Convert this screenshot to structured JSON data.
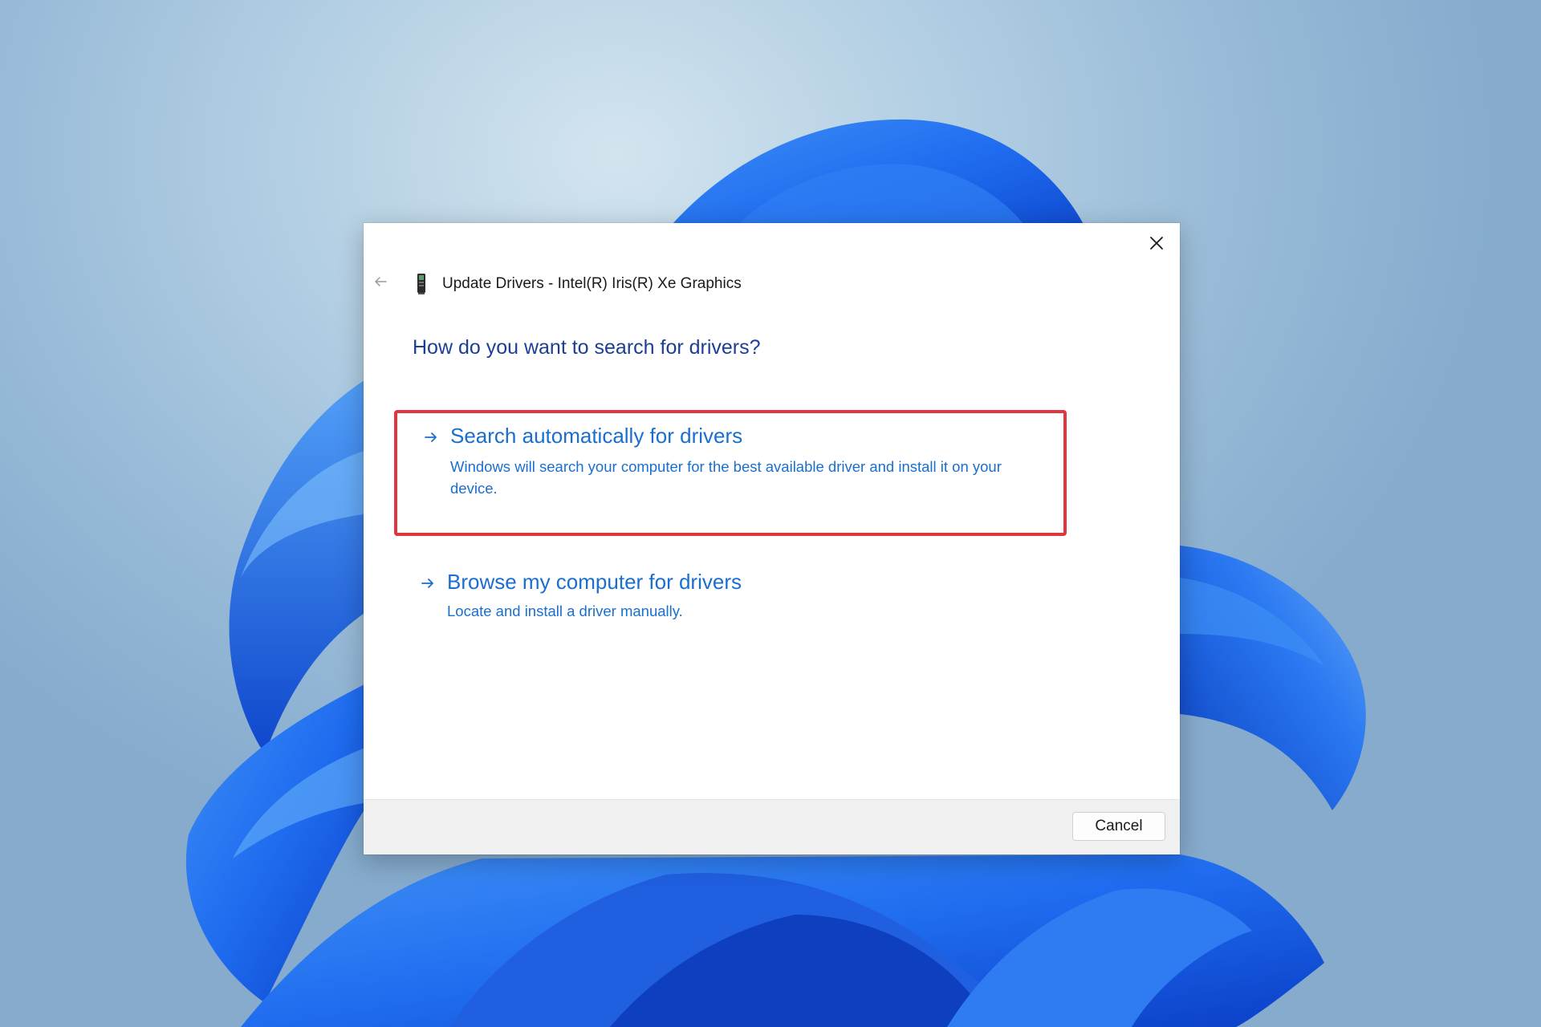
{
  "dialog": {
    "title": "Update Drivers - Intel(R) Iris(R) Xe Graphics",
    "heading": "How do you want to search for drivers?",
    "back_icon": "back-arrow-icon",
    "close_icon": "close-icon",
    "device_icon": "graphics-card-icon"
  },
  "options": [
    {
      "title": "Search automatically for drivers",
      "description": "Windows will search your computer for the best available driver and install it on your device.",
      "icon": "arrow-right-icon",
      "highlighted": true
    },
    {
      "title": "Browse my computer for drivers",
      "description": "Locate and install a driver manually.",
      "icon": "arrow-right-icon",
      "highlighted": false
    }
  ],
  "footer": {
    "cancel_label": "Cancel"
  },
  "colors": {
    "link_blue": "#1a6fce",
    "heading_blue": "#1c3f94",
    "highlight_red": "#e0363e",
    "footer_bg": "#f0f0f0"
  }
}
